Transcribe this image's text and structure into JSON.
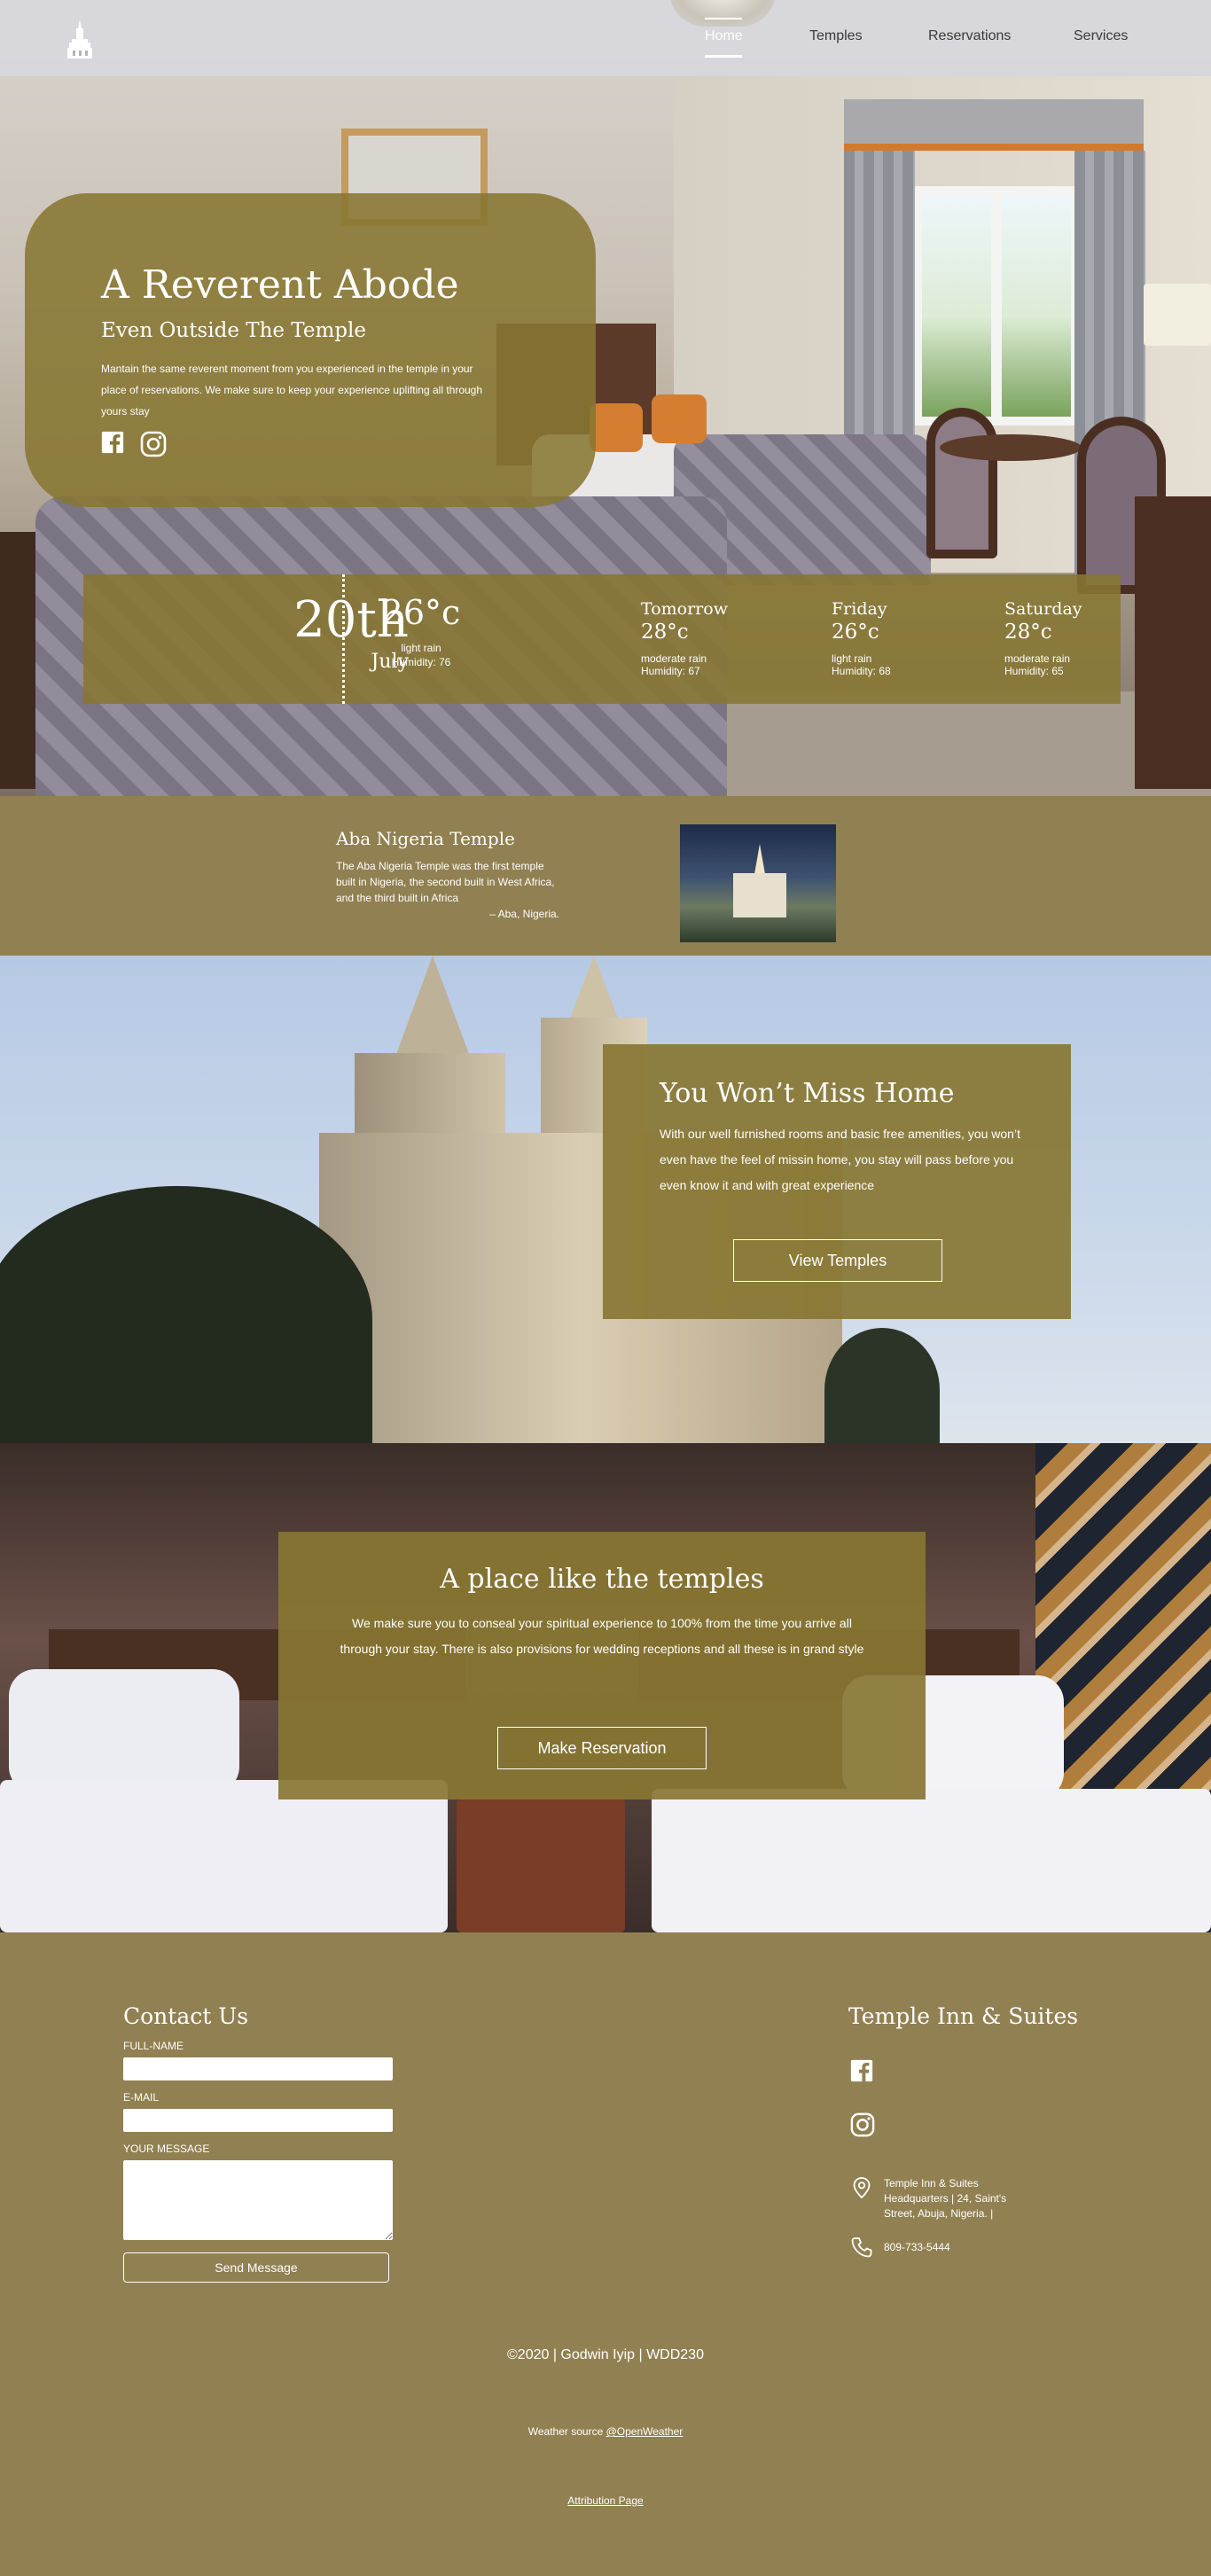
{
  "nav": {
    "logo_icon": "temple-logo-icon",
    "items": [
      {
        "label": "Home",
        "active": true
      },
      {
        "label": "Temples",
        "active": false
      },
      {
        "label": "Reservations",
        "active": false
      },
      {
        "label": "Services",
        "active": false
      }
    ]
  },
  "hero": {
    "title": "A Reverent Abode",
    "subtitle": "Even Outside The Temple",
    "description": "Mantain the same reverent moment from you experienced in the temple in your place of reservations. We make sure to keep your experience uplifting all through yours stay",
    "socials": [
      "facebook-icon",
      "instagram-icon"
    ]
  },
  "weather": {
    "day": "20th",
    "month": "July",
    "today": {
      "temp": "26°c",
      "desc": "light rain",
      "humidity": "Humidity: 76"
    },
    "forecast": [
      {
        "day": "Tomorrow",
        "temp": "28°c",
        "desc": "moderate rain",
        "humidity": "Humidity: 67"
      },
      {
        "day": "Friday",
        "temp": "26°c",
        "desc": "light rain",
        "humidity": "Humidity: 68"
      },
      {
        "day": "Saturday",
        "temp": "28°c",
        "desc": "moderate rain",
        "humidity": "Humidity: 65"
      }
    ]
  },
  "temple": {
    "name": "Aba Nigeria Temple",
    "description": "The Aba Nigeria Temple was the first temple built in Nigeria, the second built in West Africa, and the third built in Africa",
    "location": "– Aba, Nigeria."
  },
  "home_section": {
    "title": "You Won’t Miss Home",
    "text": "With our well furnished rooms and basic free amenities, you won’t even have the feel of missin home, you stay will pass before you even know it and with great experience",
    "button": "View Temples"
  },
  "temples_section": {
    "title": "A place like the temples",
    "text": "We make sure you to conseal your spiritual experience to 100% from the time you arrive all through your stay. There is also provisions for wedding receptions and all these is in grand style",
    "button": "Make Reservation"
  },
  "contact": {
    "title": "Contact Us",
    "name_label": "FULL-NAME",
    "email_label": "E-MAIL",
    "message_label": "YOUR MESSAGE",
    "send": "Send Message"
  },
  "info": {
    "title": "Temple Inn & Suites",
    "address": "Temple Inn & Suites Headquarters | 24, Saint's Street, Abuja, Nigeria. |",
    "phone": "809-733-5444"
  },
  "footer": {
    "copyright": "©2020 | Godwin Iyip | WDD230",
    "weather_source_prefix": "Weather source ",
    "weather_source_link": "@OpenWeather",
    "attribution": "Attribution Page"
  },
  "colors": {
    "accent": "#918052",
    "card": "#887632"
  }
}
